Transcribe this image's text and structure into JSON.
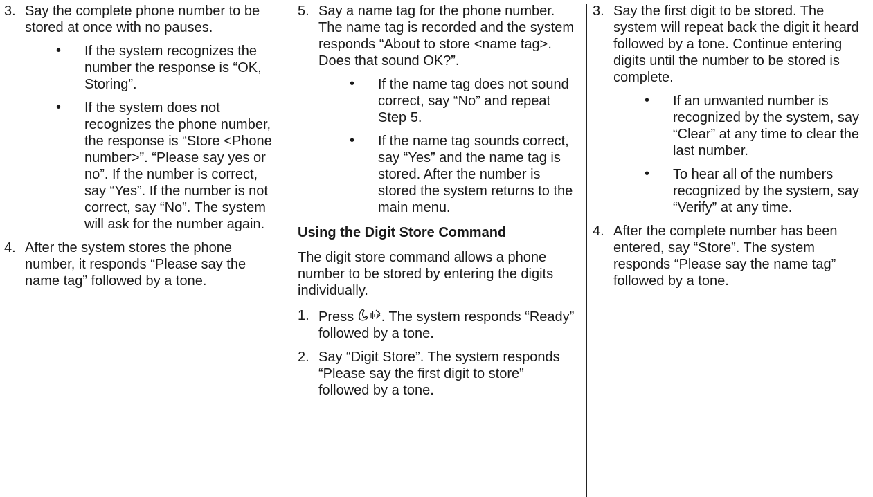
{
  "col1": {
    "step3": {
      "num": "3.",
      "text": "Say the complete phone number to be stored at once with no pauses."
    },
    "bullet1": "If the system recognizes the number the response is “OK, Storing”.",
    "bullet2": "If the system does not recognizes the phone number, the response is “Store <Phone number>”. “Please say yes or no”. If the number is correct, say “Yes”. If the number is not correct, say “No”. The system will ask for the number again.",
    "step4": {
      "num": "4.",
      "text": "After the system stores the phone number, it responds “Please say the name tag” followed by a tone."
    }
  },
  "col2": {
    "step5": {
      "num": "5.",
      "text": "Say a name tag for the phone number. The name tag is recorded and the system responds “About to store <name tag>. Does that sound OK?”."
    },
    "bullet1": "If the name tag does not sound correct, say “No” and repeat Step 5.",
    "bullet2": "If the name tag sounds correct, say “Yes” and the name tag is stored. After the number is stored the system returns to the main menu.",
    "heading": "Using the Digit Store Command",
    "intro": "The digit store command allows a phone number to be stored by entering the digits individually.",
    "step1": {
      "num": "1.",
      "before": "Press",
      "after": ". The system responds “Ready” followed by a tone."
    },
    "step2": {
      "num": "2.",
      "text": "Say “Digit Store”. The system responds “Please say the first digit to store” followed by a tone."
    }
  },
  "col3": {
    "step3": {
      "num": "3.",
      "text": "Say the first digit to be stored. The system will repeat back the digit it heard followed by a tone. Continue entering digits until the number to be stored is complete."
    },
    "bullet1": "If an unwanted number is recognized by the system, say “Clear” at any time to clear the last number.",
    "bullet2": "To hear all of the numbers recognized by the system, say “Verify” at any time.",
    "step4": {
      "num": "4.",
      "text": "After the complete number has been entered, say “Store”. The system responds “Please say the name tag” followed by a tone."
    }
  },
  "icons": {
    "phone_voice": "phone-voice-icon"
  },
  "bullet_char": "•"
}
